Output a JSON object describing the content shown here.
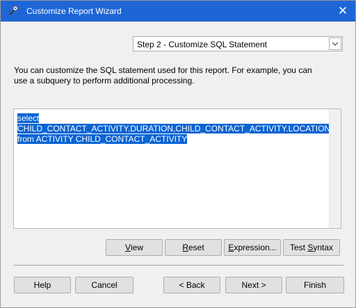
{
  "window": {
    "title": "Customize Report Wizard",
    "close_symbol": "✕"
  },
  "step_select": {
    "value": "Step 2 - Customize SQL Statement"
  },
  "description": {
    "line1": "You can customize the SQL statement used for this report. For example, you can",
    "line2": "use a subquery to perform additional processing."
  },
  "sql": {
    "lines": [
      "select",
      "CHILD_CONTACT_ACTIVITY.DURATION,CHILD_CONTACT_ACTIVITY.LOCATION",
      "from ACTIVITY CHILD_CONTACT_ACTIVITY"
    ]
  },
  "editor_buttons": {
    "view": {
      "pre": "",
      "key": "V",
      "post": "iew"
    },
    "reset": {
      "pre": "",
      "key": "R",
      "post": "eset"
    },
    "expression": {
      "pre": "",
      "key": "E",
      "post": "xpression..."
    },
    "test_syntax": {
      "pre": "Test ",
      "key": "S",
      "post": "yntax"
    }
  },
  "footer_buttons": {
    "help": "Help",
    "cancel": "Cancel",
    "back": "< Back",
    "next": "Next >",
    "finish": "Finish"
  },
  "colors": {
    "title_bar": "#1e66d6",
    "selection": "#0a64d2"
  }
}
